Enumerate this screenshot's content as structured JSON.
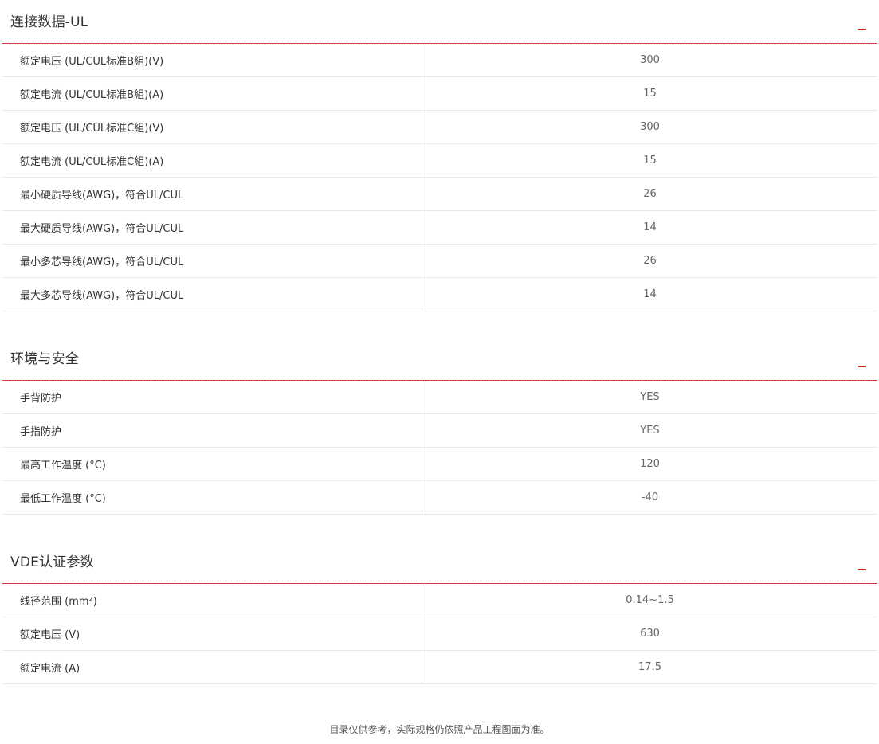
{
  "sections": [
    {
      "title": "连接数据-UL",
      "rows": [
        {
          "label": "额定电压 (UL/CUL标准B組)(V)",
          "value": "300"
        },
        {
          "label": "额定电流 (UL/CUL标准B組)(A)",
          "value": "15"
        },
        {
          "label": "额定电压 (UL/CUL标准C組)(V)",
          "value": "300"
        },
        {
          "label": "额定电流 (UL/CUL标准C組)(A)",
          "value": "15"
        },
        {
          "label": "最小硬质导线(AWG)，符合UL/CUL",
          "value": "26"
        },
        {
          "label": "最大硬质导线(AWG)，符合UL/CUL",
          "value": "14"
        },
        {
          "label": "最小多芯导线(AWG)，符合UL/CUL",
          "value": "26"
        },
        {
          "label": "最大多芯导线(AWG)，符合UL/CUL",
          "value": "14"
        }
      ]
    },
    {
      "title": "环境与安全",
      "rows": [
        {
          "label": "手背防护",
          "value": "YES"
        },
        {
          "label": "手指防护",
          "value": "YES"
        },
        {
          "label": "最高工作温度 (°C)",
          "value": "120"
        },
        {
          "label": "最低工作温度 (°C)",
          "value": "-40"
        }
      ]
    },
    {
      "title": "VDE认证参数",
      "rows": [
        {
          "label": "线径范围 (mm²)",
          "value": "0.14~1.5"
        },
        {
          "label": "额定电压 (V)",
          "value": "630"
        },
        {
          "label": "额定电流 (A)",
          "value": "17.5"
        }
      ]
    }
  ],
  "toggle_icon": "minus-icon",
  "accent_color": "#d0202a",
  "footnote": "目录仅供参考，实际规格仍依照产品工程图面为准。"
}
